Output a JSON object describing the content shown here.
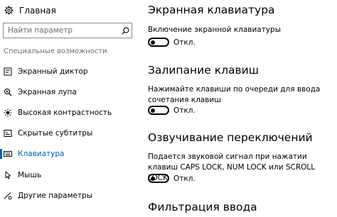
{
  "sidebar": {
    "home_label": "Главная",
    "search_placeholder": "Найти параметр",
    "section_label": "Специальные возможности",
    "items": [
      {
        "label": "Экранный диктор",
        "icon": "narrator-icon"
      },
      {
        "label": "Экранная лупа",
        "icon": "magnifier-icon"
      },
      {
        "label": "Высокая контрастность",
        "icon": "contrast-icon"
      },
      {
        "label": "Скрытые субтитры",
        "icon": "captions-icon"
      },
      {
        "label": "Клавиатура",
        "icon": "keyboard-icon",
        "active": true
      },
      {
        "label": "Мышь",
        "icon": "mouse-icon"
      },
      {
        "label": "Другие параметры",
        "icon": "other-options-icon"
      }
    ]
  },
  "main": {
    "sections": [
      {
        "title": "Экранная клавиатура",
        "description": "Включение экранной клавиатуры",
        "toggle_state": "Откл.",
        "on": false
      },
      {
        "title": "Залипание клавиш",
        "description": "Нажимайте клавиши по очереди для ввода сочетания клавиш",
        "toggle_state": "Откл.",
        "on": false
      },
      {
        "title": "Озвучивание переключений",
        "description": "Подается звуковой сигнал при нажатии клавиш CAPS LOCK, NUM LOCK или SCROLL LOCK",
        "toggle_state": "Откл.",
        "on": false
      },
      {
        "title": "Фильтрация ввода"
      }
    ]
  },
  "colors": {
    "accent": "#0063b1"
  }
}
